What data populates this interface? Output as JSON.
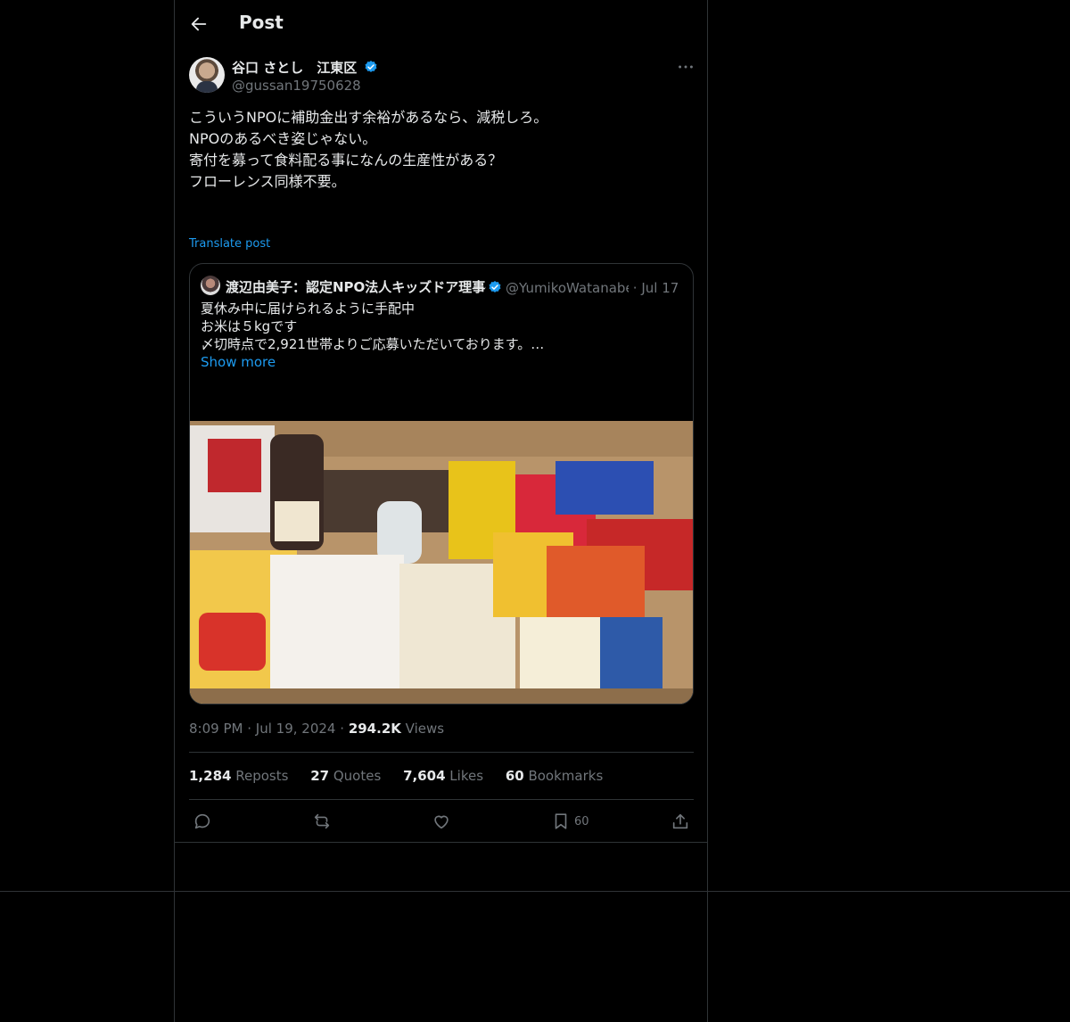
{
  "header": {
    "title": "Post"
  },
  "author": {
    "display_name": "谷口 さとし　江東区",
    "handle": "@gussan19750628",
    "verified": true
  },
  "post": {
    "lines": [
      "こういうNPOに補助金出す余裕があるなら、減税しろ。",
      "",
      "NPOのあるべき姿じゃない。",
      "寄付を募って食料配る事になんの生産性がある？",
      "",
      "フローレンス同様不要。"
    ],
    "translate_label": "Translate post"
  },
  "quote": {
    "display_name": "渡辺由美子：認定NPO法人キッズドア理事長",
    "handle": "@YumikoWatanabe_",
    "separator": "·",
    "date": "Jul 17",
    "lines": [
      "夏休み中に届けられるように手配中",
      "",
      "お米は５kgです",
      "",
      "〆切時点で2,921世帯よりご応募いただいております。…"
    ],
    "show_more": "Show more"
  },
  "meta": {
    "time": "8:09 PM",
    "sep1": "·",
    "date": "Jul 19, 2024",
    "sep2": "·",
    "views_count": "294.2K",
    "views_label": "Views"
  },
  "stats": {
    "reposts_count": "1,284",
    "reposts_label": "Reposts",
    "quotes_count": "27",
    "quotes_label": "Quotes",
    "likes_count": "7,604",
    "likes_label": "Likes",
    "bookmarks_count": "60",
    "bookmarks_label": "Bookmarks"
  },
  "actions": {
    "bookmark_count": "60",
    "icons": [
      "reply-icon",
      "repost-icon",
      "like-icon",
      "bookmark-icon",
      "share-icon"
    ]
  },
  "colors": {
    "background": "#000000",
    "text": "#e7e9ea",
    "muted": "#71767b",
    "link": "#1d9bf0",
    "border": "#2f3336"
  }
}
